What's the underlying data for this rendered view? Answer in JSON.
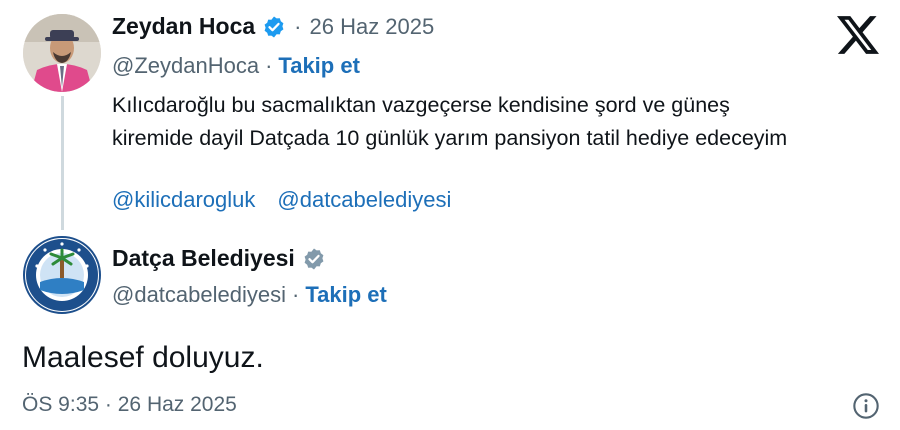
{
  "original_tweet": {
    "author_name": "Zeydan Hoca",
    "separator": "·",
    "date": "26 Haz 2025",
    "handle": "@ZeydanHoca",
    "follow_label": "Takip et",
    "text": "Kılıcdaroğlu bu sacmalıktan  vazgeçerse  kendisine şord ve güneş kiremide dayil Datçada  10 günlük yarım pansiyon tatil hediye edeceyim",
    "mentions": [
      "@kilicdarogluk",
      "@datcabelediyesi"
    ],
    "verified_badge": "blue-check-icon"
  },
  "reply_tweet": {
    "author_name": "Datça Belediyesi",
    "handle": "@datcabelediyesi",
    "separator": "·",
    "follow_label": "Takip et",
    "text": "Maalesef doluyuz.",
    "time": "ÖS 9:35",
    "date": "26 Haz 2025",
    "verified_badge": "gray-check-icon"
  },
  "icons": {
    "x_logo": "x-logo-icon",
    "info": "info-icon"
  },
  "colors": {
    "link_blue": "#1d6fb8",
    "verified_blue": "#1d9bf0",
    "verified_gray": "#829aab",
    "muted_text": "#536471",
    "main_text": "#0f1419"
  }
}
